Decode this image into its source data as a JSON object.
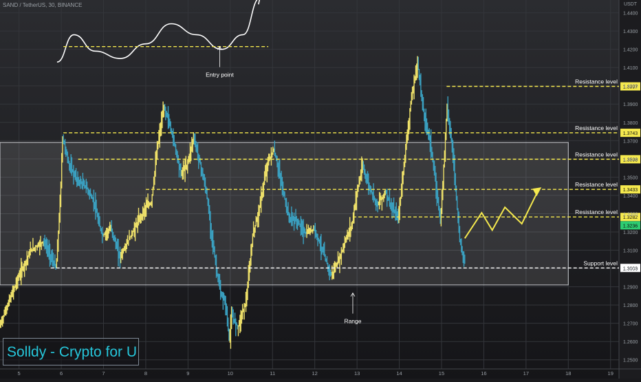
{
  "header": {
    "symbol": "SAND / TetherUS, 30, BINANCE",
    "unit": "USDT"
  },
  "brand": {
    "text": "Solldy - Crypto for U"
  },
  "colors": {
    "background": "#1a1a1d",
    "level_line": "#f5e94e",
    "support_line": "#ffffff",
    "range_box": "#ffffff",
    "candle_up": "#f0e26a",
    "candle_down": "#3aa0c0",
    "projection": "#f5e94e"
  },
  "chart_data": {
    "type": "line",
    "title": "",
    "xlabel": "",
    "ylabel": "",
    "x_ticks": [
      "5",
      "6",
      "7",
      "8",
      "9",
      "10",
      "11",
      "12",
      "13",
      "14",
      "15",
      "16",
      "17",
      "18",
      "19"
    ],
    "y_ticks": [
      "1.4400",
      "1.4300",
      "1.4200",
      "1.4100",
      "1.4000",
      "1.3900",
      "1.3800",
      "1.3700",
      "1.3600",
      "1.3500",
      "1.3400",
      "1.3300",
      "1.3200",
      "1.3100",
      "1.3000",
      "1.2900",
      "1.2800",
      "1.2700",
      "1.2600",
      "1.2500"
    ],
    "ylim": [
      1.245,
      1.447
    ],
    "xlim": [
      4.55,
      19.2
    ],
    "price_path": {
      "name": "",
      "x": [
        4.55,
        4.8,
        5.0,
        5.3,
        5.6,
        5.9,
        6.0,
        6.05,
        6.2,
        6.4,
        6.6,
        6.8,
        6.9,
        7.0,
        7.2,
        7.4,
        7.6,
        7.8,
        8.0,
        8.15,
        8.3,
        8.45,
        8.55,
        8.7,
        8.85,
        9.0,
        9.15,
        9.3,
        9.45,
        9.6,
        9.7,
        9.8,
        9.9,
        10.0,
        10.05,
        10.2,
        10.4,
        10.55,
        10.7,
        10.9,
        11.05,
        11.2,
        11.4,
        11.6,
        11.8,
        12.0,
        12.2,
        12.4,
        12.6,
        12.75,
        12.9,
        13.0,
        13.15,
        13.3,
        13.5,
        13.7,
        13.85,
        14.0,
        14.15,
        14.3,
        14.45,
        14.6,
        14.75,
        14.9,
        15.0,
        15.15,
        15.3,
        15.45,
        15.55
      ],
      "y": [
        1.268,
        1.283,
        1.295,
        1.31,
        1.315,
        1.3,
        1.34,
        1.372,
        1.357,
        1.348,
        1.345,
        1.336,
        1.325,
        1.318,
        1.322,
        1.306,
        1.315,
        1.324,
        1.333,
        1.336,
        1.368,
        1.388,
        1.382,
        1.368,
        1.352,
        1.357,
        1.372,
        1.358,
        1.342,
        1.315,
        1.298,
        1.285,
        1.282,
        1.26,
        1.274,
        1.268,
        1.283,
        1.318,
        1.332,
        1.358,
        1.365,
        1.35,
        1.328,
        1.326,
        1.319,
        1.322,
        1.31,
        1.296,
        1.305,
        1.316,
        1.324,
        1.34,
        1.356,
        1.345,
        1.335,
        1.342,
        1.332,
        1.328,
        1.362,
        1.392,
        1.413,
        1.384,
        1.37,
        1.342,
        1.326,
        1.39,
        1.36,
        1.315,
        1.305
      ]
    },
    "levels": [
      {
        "label": "Resistance level",
        "value": 1.3997,
        "badge": "1.3997",
        "x_start": 15.12,
        "style": "dashed",
        "color": "#f5e94e"
      },
      {
        "label": "Resistance level",
        "value": 1.3743,
        "badge": "1.3743",
        "x_start": 6.05,
        "style": "dashed",
        "color": "#f5e94e"
      },
      {
        "label": "Resistance level",
        "value": 1.3598,
        "badge": "1.3598",
        "x_start": 6.4,
        "style": "dashed",
        "color": "#f5e94e"
      },
      {
        "label": "Resistance level",
        "value": 1.3433,
        "badge": "1.3433",
        "x_start": 8.0,
        "style": "dashed",
        "color": "#f5e94e"
      },
      {
        "label": "Resistance level",
        "value": 1.3282,
        "badge": "1.3282",
        "x_start": 12.9,
        "style": "dashed",
        "color": "#f5e94e"
      },
      {
        "label": "Support level",
        "value": 1.3003,
        "badge": "1.3003",
        "x_start": 5.75,
        "style": "dashed",
        "color": "#ffffff"
      }
    ],
    "current_price": {
      "value": 1.3236,
      "badge": "1.3236",
      "color": "#2ecc71"
    },
    "range_box": {
      "x": [
        4.55,
        18.0
      ],
      "y": [
        1.291,
        1.369
      ],
      "label": "Range"
    },
    "projection": {
      "x": [
        15.55,
        15.95,
        16.2,
        16.5,
        16.9,
        17.3
      ],
      "y": [
        1.3165,
        1.3305,
        1.321,
        1.3335,
        1.3245,
        1.3433
      ]
    },
    "annotations": [
      {
        "text": "Entry point",
        "x": 9.75,
        "y": 1.405
      },
      {
        "text": "Range",
        "x": 12.9,
        "y": 1.27
      }
    ],
    "illustration": {
      "curve": {
        "x": [
          5.9,
          6.3,
          6.8,
          7.4,
          8.0,
          8.6,
          9.2,
          9.8,
          10.3,
          10.7
        ],
        "y": [
          1.413,
          1.428,
          1.419,
          1.415,
          1.423,
          1.434,
          1.428,
          1.42,
          1.428,
          1.448
        ]
      },
      "dashed_line": {
        "x": [
          6.05,
          10.9
        ],
        "y": 1.4215
      }
    }
  }
}
